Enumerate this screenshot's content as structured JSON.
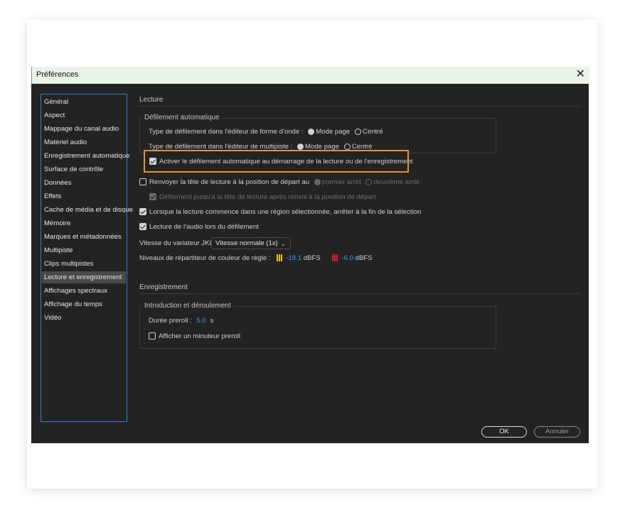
{
  "window": {
    "title": "Préférences",
    "close_glyph": "✕"
  },
  "sidebar": {
    "items": [
      {
        "label": "Général"
      },
      {
        "label": "Aspect"
      },
      {
        "label": "Mappage du canal audio"
      },
      {
        "label": "Matériel audio"
      },
      {
        "label": "Enregistrement automatique"
      },
      {
        "label": "Surface de contrôle"
      },
      {
        "label": "Données"
      },
      {
        "label": "Effets"
      },
      {
        "label": "Cache de média et de disque"
      },
      {
        "label": "Mémoire"
      },
      {
        "label": "Marques et métadonnées"
      },
      {
        "label": "Multipiste"
      },
      {
        "label": "Clips multipistes"
      },
      {
        "label": "Lecture et enregistrement",
        "selected": true
      },
      {
        "label": "Affichages spectraux"
      },
      {
        "label": "Affichage du temps"
      },
      {
        "label": "Vidéo"
      }
    ]
  },
  "playback": {
    "section_title": "Lecture",
    "autoscroll": {
      "group_title": "Défilement automatique",
      "waveform_label": "Type de défilement dans l'éditeur de forme d'onde :",
      "multitrack_label": "Type de défilement dans l'éditeur de multipiste :",
      "page_mode": "Mode page",
      "centered": "Centré",
      "enable_label": "Activer le défilement automatique au démarrage de la lecture ou de l'enregistrement",
      "enable_checked": true
    },
    "return_cti": {
      "label": "Renvoyer la tête de lecture à la position de départ au",
      "checked": false,
      "first_stop": "premier arrêt",
      "second_stop": "deuxième arrêt",
      "scroll_label": "Défilement jusqu'à la tête de lecture après renvoi à la position de départ",
      "scroll_checked": true
    },
    "stop_at_selection": {
      "label": "Lorsque la lecture commence dans une région sélectionnée, arrêter à la fin de la sélection",
      "checked": true
    },
    "scrub_audio": {
      "label": "Lecture de l'audio lors du défilement",
      "checked": true
    },
    "jkl": {
      "label": "Vitesse du variateur JKL :",
      "value": "Vitesse normale (1x)"
    },
    "ruler": {
      "label": "Niveaux de répartiteur de couleur de règle :",
      "yellow_value": "-18.1",
      "red_value": "-6.0",
      "unit": "dBFS",
      "yellow_color": "#f2c200",
      "red_color": "#e0242e"
    }
  },
  "recording": {
    "section_title": "Enregistrement",
    "group_title": "Introduction et déroulement",
    "preroll_label": "Durée preroll :",
    "preroll_value": "5.0",
    "preroll_unit": "s",
    "timer_label": "Afficher un minuteur preroll",
    "timer_checked": false
  },
  "buttons": {
    "ok": "OK",
    "cancel": "Annuler"
  }
}
